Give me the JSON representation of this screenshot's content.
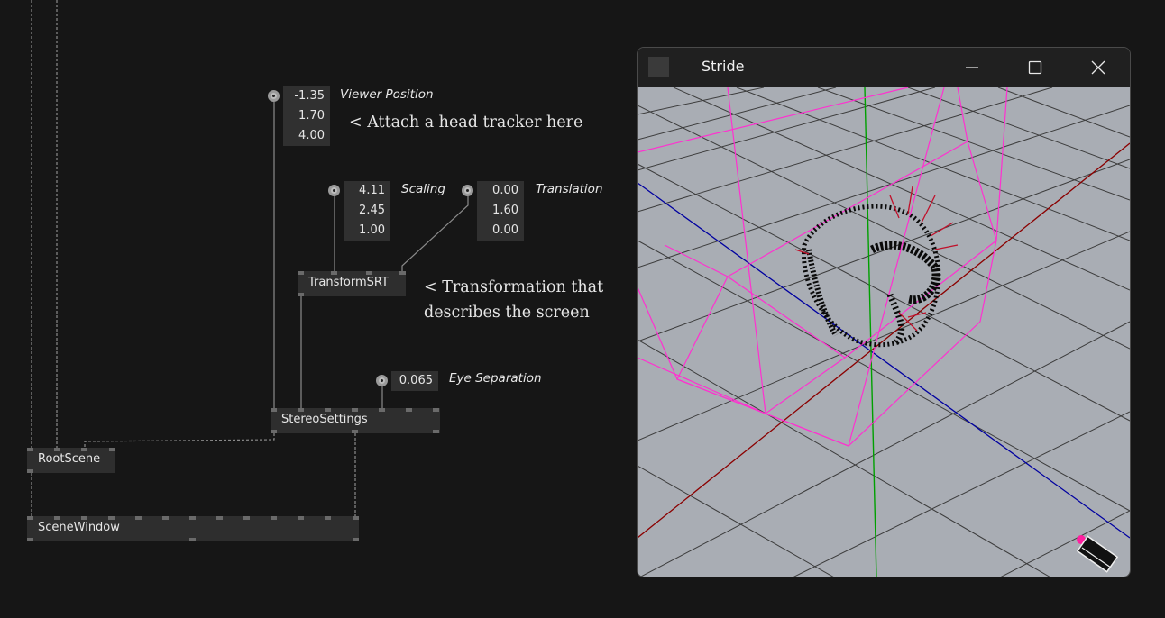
{
  "nodes": {
    "transform_srt": "TransformSRT",
    "stereo_settings": "StereoSettings",
    "root_scene": "RootScene",
    "scene_window": "SceneWindow"
  },
  "iobox": {
    "viewer_position": {
      "label": "Viewer Position",
      "values": [
        "-1.35",
        "1.70",
        "4.00"
      ]
    },
    "scaling": {
      "label": "Scaling",
      "values": [
        "4.11",
        "2.45",
        "1.00"
      ]
    },
    "translation": {
      "label": "Translation",
      "values": [
        "0.00",
        "1.60",
        "0.00"
      ]
    },
    "eye_separation": {
      "label": "Eye Separation",
      "value": "0.065"
    }
  },
  "comments": {
    "head_tracker": "< Attach a head tracker here",
    "transformation_1": "< Transformation that",
    "transformation_2": "describes the screen"
  },
  "window": {
    "title": "Stride",
    "icons": [
      "minimize-icon",
      "maximize-icon",
      "close-icon"
    ]
  },
  "colors": {
    "background": "#161616",
    "node": "#2e2e2e",
    "viewport": "#a9adb4",
    "axis_x": "#8b0000",
    "axis_y": "#00a000",
    "axis_z": "#0000a0",
    "frustum": "#ff30d0"
  }
}
